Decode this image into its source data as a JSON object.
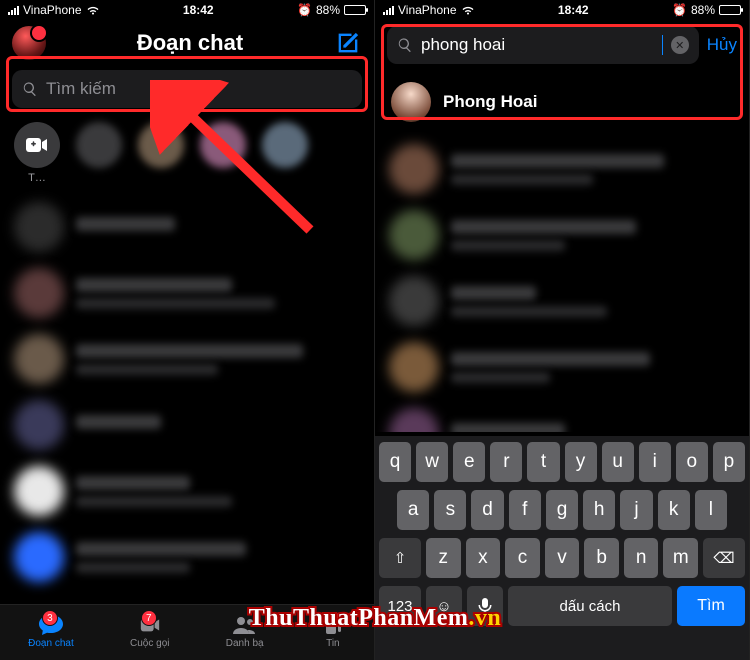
{
  "statusbar": {
    "carrier": "VinaPhone",
    "time": "18:42",
    "battery_pct": "88%",
    "battery_icon": "battery-icon",
    "wifi_icon": "wifi-icon",
    "alarm_icon": "alarm-icon"
  },
  "left": {
    "title": "Đoạn chat",
    "search_placeholder": "Tìm kiếm",
    "story_create_label": "T…",
    "tabs": {
      "chats": {
        "label": "Đoạn chat",
        "badge": "3"
      },
      "calls": {
        "label": "Cuộc gọi",
        "badge": "7"
      },
      "people": {
        "label": "Danh bạ"
      },
      "stories": {
        "label": "Tin"
      }
    }
  },
  "right": {
    "search_value": "phong hoai",
    "cancel": "Hủy",
    "result_name": "Phong Hoai"
  },
  "keyboard": {
    "row1": [
      "q",
      "w",
      "e",
      "r",
      "t",
      "y",
      "u",
      "i",
      "o",
      "p"
    ],
    "row2": [
      "a",
      "s",
      "d",
      "f",
      "g",
      "h",
      "j",
      "k",
      "l"
    ],
    "row3": [
      "z",
      "x",
      "c",
      "v",
      "b",
      "n",
      "m"
    ],
    "shift": "⇧",
    "backspace": "⌫",
    "numbers": "123",
    "emoji": "☺",
    "mic": "mic-icon",
    "space": "dấu cách",
    "search": "Tìm"
  },
  "watermark": {
    "main": "ThuThuatPhanMem",
    "suffix": ".vn"
  }
}
